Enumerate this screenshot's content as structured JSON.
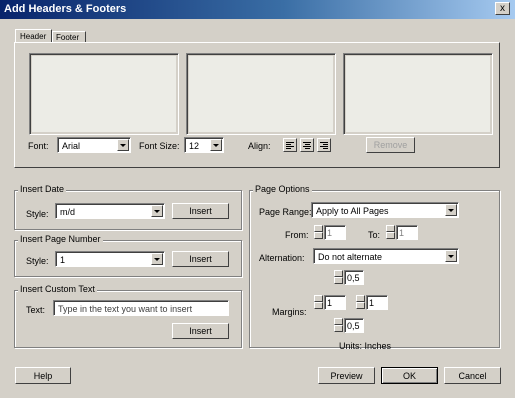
{
  "window": {
    "title": "Add Headers & Footers",
    "close_glyph": "x"
  },
  "tabs": [
    {
      "label": "Header"
    },
    {
      "label": "Footer"
    }
  ],
  "header_tab": {
    "font_label": "Font:",
    "font_value": "Arial",
    "font_size_label": "Font Size:",
    "font_size_value": "12",
    "align_label": "Align:",
    "remove_label": "Remove"
  },
  "insert_date": {
    "legend": "Insert Date",
    "style_label": "Style:",
    "style_value": "m/d",
    "insert_label": "Insert"
  },
  "insert_page_number": {
    "legend": "Insert Page Number",
    "style_label": "Style:",
    "style_value": "1",
    "insert_label": "Insert"
  },
  "insert_custom_text": {
    "legend": "Insert Custom Text",
    "text_label": "Text:",
    "text_placeholder": "Type in the text you want to insert",
    "insert_label": "Insert"
  },
  "page_options": {
    "legend": "Page Options",
    "page_range_label": "Page Range:",
    "page_range_value": "Apply to All Pages",
    "from_label": "From:",
    "from_value": "1",
    "to_label": "To:",
    "to_value": "1",
    "alternation_label": "Alternation:",
    "alternation_value": "Do not alternate",
    "margins_label": "Margins:",
    "margin_top": "0,5",
    "margin_left": "1",
    "margin_right": "1",
    "margin_bottom": "0,5",
    "units_label": "Units: Inches"
  },
  "footer_buttons": {
    "help": "Help",
    "preview": "Preview",
    "ok": "OK",
    "cancel": "Cancel"
  }
}
